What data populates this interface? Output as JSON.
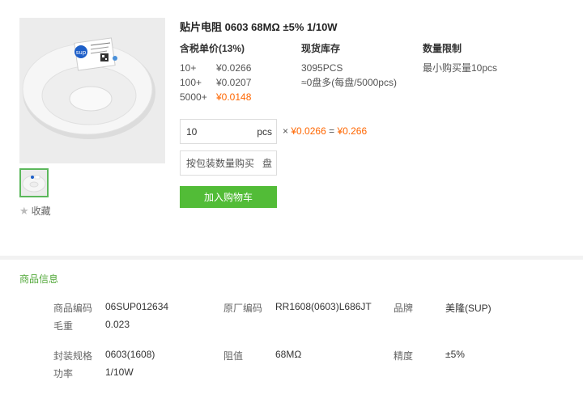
{
  "product": {
    "title": "贴片电阻 0603 68MΩ ±5% 1/10W",
    "favorite_label": "收藏",
    "image_text": {
      "brand_logo": "sup",
      "label_lines": [
        "RR1608(0603)",
        "68MΩ ±5%",
        "5000PCS"
      ]
    }
  },
  "pricing": {
    "header": "含税单价(13%)",
    "tiers": [
      {
        "qty": "10+",
        "price": "¥0.0266",
        "highlight": false
      },
      {
        "qty": "100+",
        "price": "¥0.0207",
        "highlight": false
      },
      {
        "qty": "5000+",
        "price": "¥0.0148",
        "highlight": true
      }
    ]
  },
  "stock": {
    "header": "现货库存",
    "count": "3095PCS",
    "reels": "≈0盘多(每盘/5000pcs)"
  },
  "limit": {
    "header": "数量限制",
    "min": "最小购买量10pcs"
  },
  "order": {
    "quantity": "10",
    "unit": "pcs",
    "times": "×",
    "unit_price": "¥0.0266",
    "equals": "=",
    "total": "¥0.266",
    "reel_placeholder": "按包装数量购买",
    "reel_unit": "盘",
    "cart_button": "加入购物车"
  },
  "info": {
    "section_title": "商品信息",
    "fields": {
      "code_label": "商品编码",
      "code": "06SUP012634",
      "mfr_label": "原厂编码",
      "mfr": "RR1608(0603)L686JT",
      "brand_label": "品牌",
      "brand": "美隆(SUP)",
      "weight_label": "毛重",
      "weight": "0.023",
      "package_label": "封装规格",
      "package": "0603(1608)",
      "resistance_label": "阻值",
      "resistance": "68MΩ",
      "accuracy_label": "精度",
      "accuracy": "±5%",
      "power_label": "功率",
      "power": "1/10W"
    }
  },
  "colors": {
    "accent_green": "#52bc37",
    "price_orange": "#ff6600",
    "section_green": "#52a83a"
  }
}
